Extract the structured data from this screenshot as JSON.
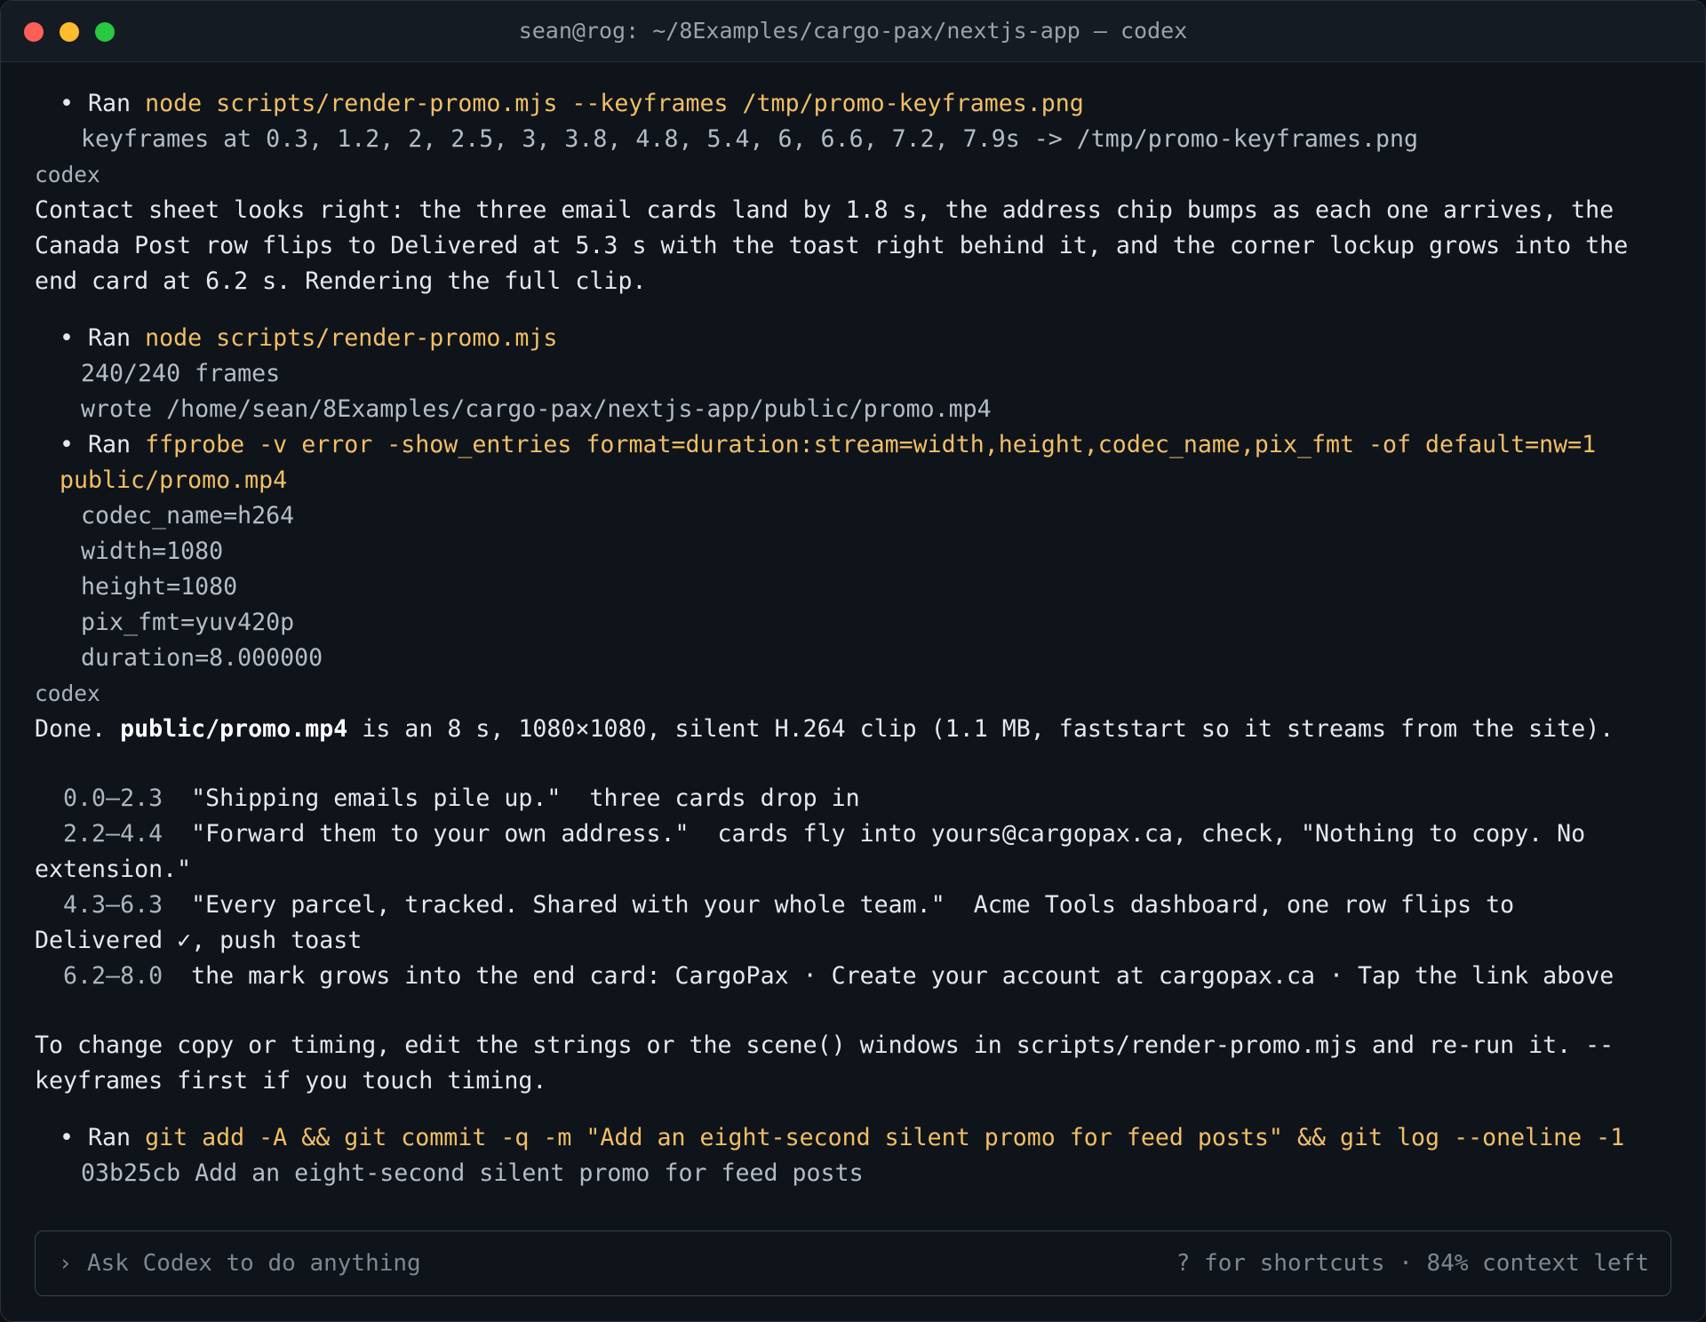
{
  "window": {
    "title": "sean@rog: ~/8Examples/cargo-pax/nextjs-app — codex",
    "colors": {
      "close": "#ff5f57",
      "minimize": "#febc2e",
      "maximize": "#28c840",
      "command": "#f2bf63"
    }
  },
  "log": {
    "run1": {
      "bullet": "• Ran ",
      "command": "node scripts/render-promo.mjs --keyframes /tmp/promo-keyframes.png",
      "output": "keyframes at 0.3, 1.2, 2, 2.5, 3, 3.8, 4.8, 5.4, 6, 6.6, 7.2, 7.9s -> /tmp/promo-keyframes.png"
    },
    "codex_label_1": "codex",
    "message1": [
      "Contact sheet looks right: the three email cards land by 1.8 s, the address chip bumps as each one arrives, the",
      "Canada Post row flips to Delivered at 5.3 s with the toast right behind it, and the corner lockup grows into the",
      "end card at 6.2 s. Rendering the full clip."
    ],
    "run2": {
      "bullet": "• Ran ",
      "command": "node scripts/render-promo.mjs",
      "output": [
        "240/240 frames",
        "wrote /home/sean/8Examples/cargo-pax/nextjs-app/public/promo.mp4"
      ]
    },
    "run3": {
      "bullet": "• Ran ",
      "command_line1": "ffprobe -v error -show_entries format=duration:stream=width,height,codec_name,pix_fmt -of default=nw=1",
      "command_line2": "public/promo.mp4",
      "output": [
        "codec_name=h264",
        "width=1080",
        "height=1080",
        "pix_fmt=yuv420p",
        "duration=8.000000"
      ]
    },
    "codex_label_2": "codex",
    "done": {
      "prefix": "Done. ",
      "file": "public/promo.mp4",
      "suffix": " is an 8 s, 1080×1080, silent H.264 clip (1.1 MB, faststart so it streams from the site)."
    },
    "timeline": [
      {
        "time": "  0.0–2.3",
        "text": "  \"Shipping emails pile up.\"  three cards drop in",
        "wrap": ""
      },
      {
        "time": "  2.2–4.4",
        "text": "  \"Forward them to your own address.\"  cards fly into yours@cargopax.ca, check, \"Nothing to copy. No",
        "wrap": "extension.\""
      },
      {
        "time": "  4.3–6.3",
        "text": "  \"Every parcel, tracked. Shared with your whole team.\"  Acme Tools dashboard, one row flips to",
        "wrap": "Delivered ✓, push toast"
      },
      {
        "time": "  6.2–8.0",
        "text": "  the mark grows into the end card: CargoPax · Create your account at cargopax.ca · Tap the link above",
        "wrap": ""
      }
    ],
    "change_note": [
      "To change copy or timing, edit the strings or the scene() windows in scripts/render-promo.mjs and re-run it. --",
      "keyframes first if you touch timing."
    ],
    "run4": {
      "bullet": "• Ran ",
      "command": "git add -A && git commit -q -m \"Add an eight-second silent promo for feed posts\" && git log --oneline -1",
      "output": "03b25cb Add an eight-second silent promo for feed posts"
    }
  },
  "input": {
    "prompt_symbol": "›",
    "placeholder": "Ask Codex to do anything",
    "hint": "? for shortcuts · 84% context left"
  }
}
